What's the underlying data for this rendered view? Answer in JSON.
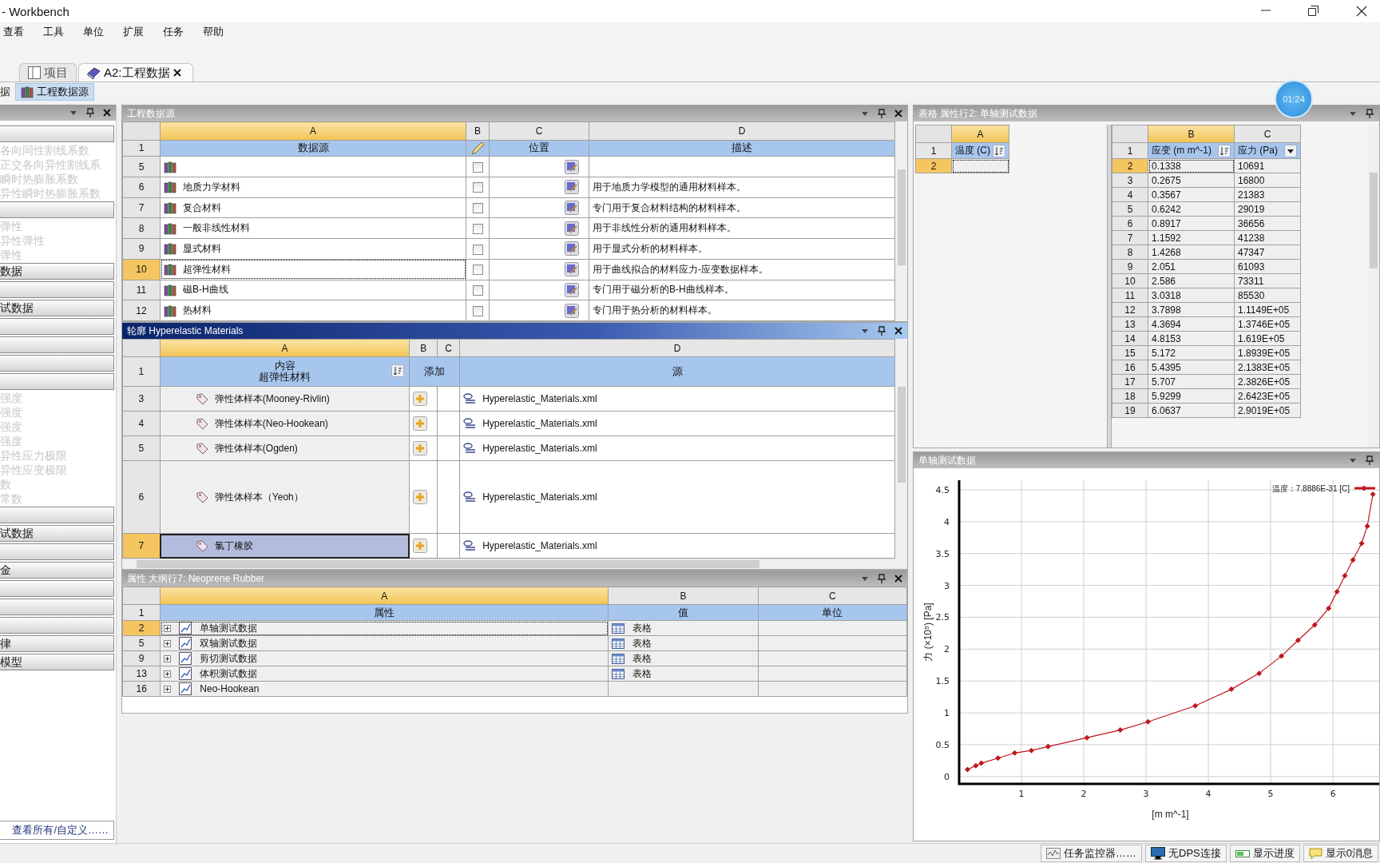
{
  "window": {
    "title": "- Workbench"
  },
  "menu": [
    {
      "label": "查看"
    },
    {
      "label": "工具"
    },
    {
      "label": "单位"
    },
    {
      "label": "扩展"
    },
    {
      "label": "任务"
    },
    {
      "label": "帮助"
    }
  ],
  "tabs": [
    {
      "label": "项目",
      "selected": false
    },
    {
      "label": "A2:工程数据",
      "selected": true
    }
  ],
  "breadcrumb": [
    {
      "label": "据",
      "selected": false
    },
    {
      "label": "工程数据源",
      "selected": true
    }
  ],
  "toolbox": {
    "items": [
      {
        "kind": "bar"
      },
      {
        "kind": "text",
        "label": "各向同性割线系数"
      },
      {
        "kind": "text",
        "label": "正交各向异性割线系"
      },
      {
        "kind": "text",
        "label": "瞬时热膨胀系数"
      },
      {
        "kind": "text",
        "label": "异性瞬时热膨胀系数"
      },
      {
        "kind": "bar"
      },
      {
        "kind": "text",
        "label": "弹性"
      },
      {
        "kind": "text",
        "label": "异性弹性"
      },
      {
        "kind": "text",
        "label": "弹性"
      },
      {
        "kind": "bar",
        "label": "数据"
      },
      {
        "kind": "bar"
      },
      {
        "kind": "bar",
        "label": "试数据"
      },
      {
        "kind": "bar"
      },
      {
        "kind": "bar"
      },
      {
        "kind": "bar"
      },
      {
        "kind": "bar"
      },
      {
        "kind": "text",
        "label": "强度"
      },
      {
        "kind": "text",
        "label": "强度"
      },
      {
        "kind": "text",
        "label": "强度"
      },
      {
        "kind": "text",
        "label": "强度"
      },
      {
        "kind": "text",
        "label": "异性应力极限"
      },
      {
        "kind": "text",
        "label": "异性应变极限"
      },
      {
        "kind": "text",
        "label": "数"
      },
      {
        "kind": "text",
        "label": "常数"
      },
      {
        "kind": "bar"
      },
      {
        "kind": "bar",
        "label": "试数据"
      },
      {
        "kind": "bar"
      },
      {
        "kind": "bar",
        "label": "金"
      },
      {
        "kind": "bar"
      },
      {
        "kind": "bar"
      },
      {
        "kind": "bar"
      },
      {
        "kind": "bar",
        "label": "律"
      },
      {
        "kind": "bar",
        "label": "模型"
      }
    ],
    "footer_link": "查看所有/自定义……"
  },
  "sources": {
    "title": "工程数据源",
    "header_number": "1",
    "columns": [
      {
        "label": "A",
        "selected": true
      },
      {
        "label": "B",
        "selected": false
      },
      {
        "label": "C",
        "selected": false
      },
      {
        "label": "D",
        "selected": false
      }
    ],
    "header": {
      "name": "数据源",
      "location": "位置",
      "description": "描述"
    },
    "rows": [
      {
        "number": "5",
        "checked": false,
        "selected": false
      },
      {
        "number": "6",
        "name": "地质力学材料",
        "description": "用于地质力学模型的通用材料样本。",
        "checked": false,
        "selected": false
      },
      {
        "number": "7",
        "name": "复合材料",
        "description": "专门用于复合材料结构的材料样本。",
        "checked": false,
        "selected": false
      },
      {
        "number": "8",
        "name": "一般非线性材料",
        "description": "用于非线性分析的通用材料样本。",
        "checked": false,
        "selected": false
      },
      {
        "number": "9",
        "name": "显式材料",
        "description": "用于显式分析的材料样本。",
        "checked": false,
        "selected": false
      },
      {
        "number": "10",
        "name": "超弹性材料",
        "description": "用于曲线拟合的材料应力-应变数据样本。",
        "checked": false,
        "selected": true
      },
      {
        "number": "11",
        "name": "磁B-H曲线",
        "description": "专门用于磁分析的B-H曲线样本。",
        "checked": false,
        "selected": false
      },
      {
        "number": "12",
        "name": "热材料",
        "description": "专门用于热分析的材料样本。",
        "checked": false,
        "selected": false
      }
    ]
  },
  "outline": {
    "title": "轮廓 Hyperelastic Materials",
    "header_number": "1",
    "columns": [
      {
        "label": "A",
        "selected": true
      },
      {
        "label": "B",
        "selected": false
      },
      {
        "label": "C",
        "selected": false
      },
      {
        "label": "D",
        "selected": false
      }
    ],
    "header": {
      "content": "内容",
      "library": "超弹性材料",
      "add": "添加",
      "source": "源"
    },
    "rows": [
      {
        "number": "3",
        "name": "弹性体样本(Mooney-Rivlin)",
        "source": "Hyperelastic_Materials.xml",
        "selected": false
      },
      {
        "number": "4",
        "name": "弹性体样本(Neo-Hookean)",
        "source": "Hyperelastic_Materials.xml",
        "selected": false
      },
      {
        "number": "5",
        "name": "弹性体样本(Ogden)",
        "source": "Hyperelastic_Materials.xml",
        "selected": false
      },
      {
        "number": "6",
        "name": "弹性体样本（Yeoh）",
        "source": "Hyperelastic_Materials.xml",
        "selected": false
      },
      {
        "number": "7",
        "name": "氯丁橡胶",
        "source": "Hyperelastic_Materials.xml",
        "selected": true
      }
    ]
  },
  "properties": {
    "title": "属性 大纲行7: Neoprene Rubber",
    "header_number": "1",
    "columns": [
      {
        "label": "A",
        "selected": true
      },
      {
        "label": "B",
        "selected": false
      },
      {
        "label": "C",
        "selected": false
      }
    ],
    "header": {
      "property": "属性",
      "value": "值",
      "unit": "单位"
    },
    "rows": [
      {
        "number": "2",
        "name": "单轴测试数据",
        "value": "表格",
        "expanded": false,
        "selected": true
      },
      {
        "number": "5",
        "name": "双轴测试数据",
        "value": "表格",
        "expanded": false,
        "selected": false
      },
      {
        "number": "9",
        "name": "剪切测试数据",
        "value": "表格",
        "expanded": false,
        "selected": false
      },
      {
        "number": "13",
        "name": "体积测试数据",
        "value": "表格",
        "expanded": false,
        "selected": false
      },
      {
        "number": "16",
        "name": "Neo-Hookean",
        "expanded": false,
        "selected": false
      }
    ]
  },
  "table_panel": {
    "title": "表格 属性行2: 单轴测试数据",
    "temperature": {
      "header_number": "1",
      "columns": [
        {
          "label": "A",
          "selected": true
        }
      ],
      "header": "温度 (C)",
      "rows": [
        {
          "number": "2",
          "selected": true
        }
      ]
    },
    "data": {
      "header_number": "1",
      "columns": [
        {
          "label": "B",
          "selected": true
        },
        {
          "label": "C",
          "selected": false
        }
      ],
      "headers": [
        "应变 (m m^-1)",
        "应力 (Pa)"
      ],
      "rows": [
        {
          "number": "2",
          "strain": "0.1338",
          "stress": "10691",
          "selected": true
        },
        {
          "number": "3",
          "strain": "0.2675",
          "stress": "16800",
          "selected": false
        },
        {
          "number": "4",
          "strain": "0.3567",
          "stress": "21383",
          "selected": false
        },
        {
          "number": "5",
          "strain": "0.6242",
          "stress": "29019",
          "selected": false
        },
        {
          "number": "6",
          "strain": "0.8917",
          "stress": "36656",
          "selected": false
        },
        {
          "number": "7",
          "strain": "1.1592",
          "stress": "41238",
          "selected": false
        },
        {
          "number": "8",
          "strain": "1.4268",
          "stress": "47347",
          "selected": false
        },
        {
          "number": "9",
          "strain": "2.051",
          "stress": "61093",
          "selected": false
        },
        {
          "number": "10",
          "strain": "2.586",
          "stress": "73311",
          "selected": false
        },
        {
          "number": "11",
          "strain": "3.0318",
          "stress": "85530",
          "selected": false
        },
        {
          "number": "12",
          "strain": "3.7898",
          "stress": "1.1149E+05",
          "selected": false
        },
        {
          "number": "13",
          "strain": "4.3694",
          "stress": "1.3746E+05",
          "selected": false
        },
        {
          "number": "14",
          "strain": "4.8153",
          "stress": "1.619E+05",
          "selected": false
        },
        {
          "number": "15",
          "strain": "5.172",
          "stress": "1.8939E+05",
          "selected": false
        },
        {
          "number": "16",
          "strain": "5.4395",
          "stress": "2.1383E+05",
          "selected": false
        },
        {
          "number": "17",
          "strain": "5.707",
          "stress": "2.3826E+05",
          "selected": false
        },
        {
          "number": "18",
          "strain": "5.9299",
          "stress": "2.6423E+05",
          "selected": false
        },
        {
          "number": "19",
          "strain": "6.0637",
          "stress": "2.9019E+05",
          "selected": false
        }
      ]
    }
  },
  "chart_panel": {
    "title": "单轴测试数据",
    "chart_data": {
      "type": "line",
      "xlabel": "[m m^-1]",
      "ylabel": "力 (×10⁵) [Pa]",
      "x": [
        0.1338,
        0.2675,
        0.3567,
        0.6242,
        0.8917,
        1.1592,
        1.4268,
        2.051,
        2.586,
        3.0318,
        3.7898,
        4.3694,
        4.8153,
        5.172,
        5.4395,
        5.707,
        5.9299,
        6.0637,
        6.19,
        6.32,
        6.46,
        6.55,
        6.64
      ],
      "series": [
        {
          "name": "温度：7.8886E-31 [C]",
          "color": "#c0161e",
          "marker": true,
          "values": [
            0.11,
            0.17,
            0.21,
            0.29,
            0.37,
            0.41,
            0.47,
            0.61,
            0.73,
            0.86,
            1.11,
            1.37,
            1.62,
            1.89,
            2.14,
            2.38,
            2.64,
            2.9,
            3.15,
            3.4,
            3.66,
            3.93,
            4.43
          ]
        }
      ],
      "grid": true,
      "xlim": [
        0,
        6.78
      ],
      "ylim": [
        -0.115,
        4.65
      ],
      "xticks": [
        1,
        2,
        3,
        4,
        5,
        6
      ],
      "yticks": [
        0,
        0.5,
        1,
        1.5,
        2,
        2.5,
        3,
        3.5,
        4,
        4.5
      ]
    }
  },
  "timer": "01:24",
  "status_bar": [
    {
      "kind": "monitor",
      "label": "任务监控器……"
    },
    {
      "kind": "connection",
      "label": "无DPS连接"
    },
    {
      "kind": "progress",
      "label": "显示进度"
    },
    {
      "kind": "messages",
      "label": "显示0消息"
    }
  ]
}
